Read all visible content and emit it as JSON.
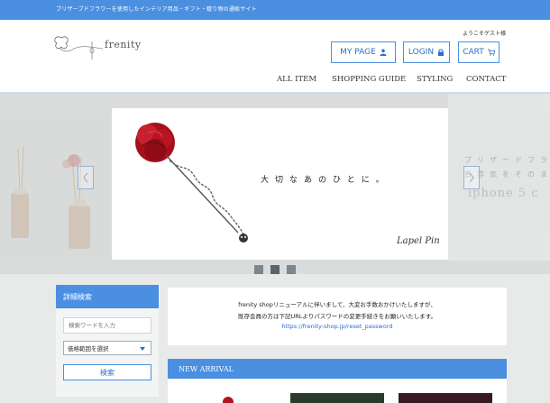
{
  "topbar": {
    "text": "プリザーブドフラワーを使用したインテリア用品・ギフト・贈り物の通販サイト"
  },
  "header": {
    "logo_text": "frenity",
    "welcome": "ようこそゲスト様",
    "buttons": {
      "mypage": "MY PAGE",
      "login": "LOGIN",
      "cart": "CART"
    },
    "nav": [
      "ALL ITEM",
      "SHOPPING GUIDE",
      "STYLING",
      "CONTACT"
    ]
  },
  "hero": {
    "tagline": "大切なあのひとに。",
    "caption": "Lapel Pin",
    "next_jp_line1": "プリザードフラ",
    "next_jp_line2": "香雰気をそのま",
    "next_text": "iphone 5 c",
    "slide_count": 3,
    "active_slide": 1
  },
  "search": {
    "title": "詳細検索",
    "keyword_placeholder": "検索ワードを入力",
    "price_select": "価格範囲を選択",
    "button": "検索"
  },
  "notice": {
    "line1": "frenity shopリニューアルに伴いまして、大変お手数おかけいたしますが、",
    "line2": "既存会員の方は下記URLよりパスワードの変更手続きをお願いいたします。",
    "link": "https://frenity-shop.jp/reset_password"
  },
  "new_arrival": {
    "title": "NEW ARRIVAL"
  },
  "colors": {
    "accent": "#4a8fe0",
    "link": "#2a6fc9",
    "rose": "#b3121f"
  }
}
